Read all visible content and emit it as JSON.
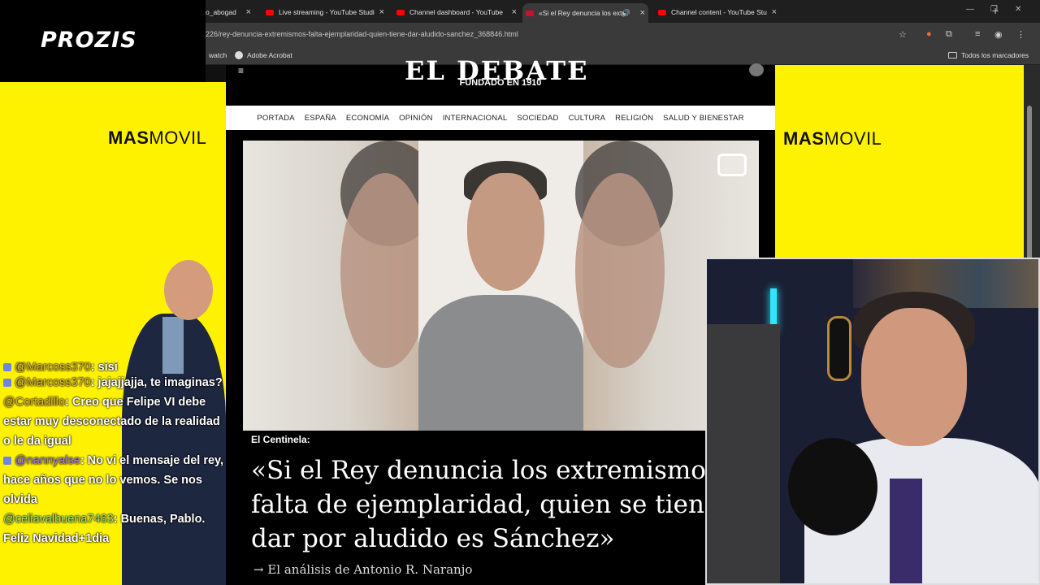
{
  "browser": {
    "tabs": [
      {
        "label": "o_abogad"
      },
      {
        "label": "Live streaming - YouTube Studi"
      },
      {
        "label": "Channel dashboard - YouTube"
      },
      {
        "label": "«Si el Rey denuncia los extr"
      },
      {
        "label": "Channel content - YouTube Stu"
      }
    ],
    "url": "226/rey-denuncia-extremismos-falta-ejemplaridad-quien-tiene-dar-aludido-sanchez_368846.html",
    "bookmarks": [
      "watch",
      "Adobe Acrobat"
    ],
    "all_bookmarks": "Todos los marcadores"
  },
  "sponsor_logo": "PROZIS",
  "site": {
    "logo": "EL DEBATE",
    "tagline": "FUNDADO EN 1910",
    "nav": [
      "PORTADA",
      "ESPAÑA",
      "ECONOMÍA",
      "OPINIÓN",
      "INTERNACIONAL",
      "SOCIEDAD",
      "CULTURA",
      "RELIGIÓN",
      "SALUD Y BIENESTAR"
    ]
  },
  "article": {
    "kicker": "El Centinela:",
    "headline_lines": [
      "«Si el Rey denuncia los extremismos y",
      "falta de ejemplaridad, quien se tiene c",
      "dar por aludido es Sánchez»"
    ],
    "byline": "El análisis de Antonio R. Naranjo"
  },
  "ads": {
    "left_brand": {
      "bold": "MAS",
      "rest": "MOVIL"
    },
    "right_brand": {
      "bold": "MAS",
      "rest": "MOVIL"
    }
  },
  "chat": [
    {
      "user": "@Marcoss370",
      "text": ": sisi",
      "style": "gold"
    },
    {
      "user": "@Marcoss370",
      "text": ": jajajjajja, te imaginas?",
      "style": "gold"
    },
    {
      "user": "@Cortadillo",
      "text": ": Creo que Felipe VI debe estar muy desconectado de la realidad o le da igual",
      "style": "gold"
    },
    {
      "user": "@nannyalse",
      "text": ": No vi el mensaje del rey, hace años que no lo vemos. Se nos olvida",
      "style": "purple"
    },
    {
      "user": "@celiavalbuena7463",
      "text": ": Buenas, Pablo. Feliz Navidad+1dia",
      "style": "green"
    }
  ],
  "colors": {
    "ad_yellow": "#fff200",
    "page_black": "#000000",
    "nav_white": "#ffffff",
    "cam_led": "#31e4ff"
  }
}
